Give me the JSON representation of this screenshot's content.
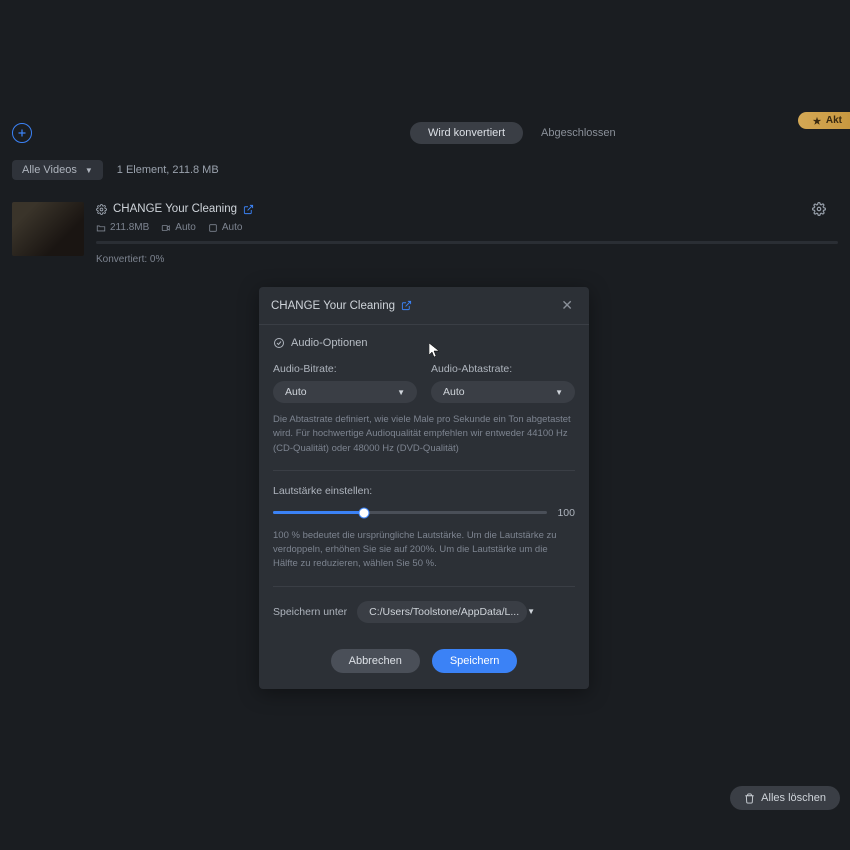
{
  "topBadge": "Akt",
  "tabs": {
    "active": "Wird konvertiert",
    "inactive": "Abgeschlossen"
  },
  "filter": {
    "label": "Alle Videos",
    "info": "1 Element, 211.8 MB"
  },
  "item": {
    "title": "CHANGE Your Cleaning",
    "size": "211.8MB",
    "auto1": "Auto",
    "auto2": "Auto",
    "progress": "Konvertiert: 0%"
  },
  "modal": {
    "title": "CHANGE Your Cleaning",
    "section": "Audio-Optionen",
    "bitrateLabel": "Audio-Bitrate:",
    "bitrateValue": "Auto",
    "samplerateLabel": "Audio-Abtastrate:",
    "samplerateValue": "Auto",
    "sampHelp": "Die Abtastrate definiert, wie viele Male pro Sekunde ein Ton abgetastet wird. Für hochwertige Audioqualität empfehlen wir entweder 44100 Hz (CD-Qualität) oder 48000 Hz (DVD-Qualität)",
    "volLabel": "Lautstärke einstellen:",
    "volMax": "100",
    "volHelp": "100 % bedeutet die ursprüngliche Lautstärke. Um die Lautstärke zu verdoppeln, erhöhen Sie sie auf 200%. Um die Lautstärke um die Hälfte zu reduzieren, wählen Sie 50 %.",
    "saveLabel": "Speichern unter",
    "savePath": "C:/Users/Toolstone/AppData/L...",
    "cancel": "Abbrechen",
    "save": "Speichern"
  },
  "clearAll": "Alles löschen"
}
